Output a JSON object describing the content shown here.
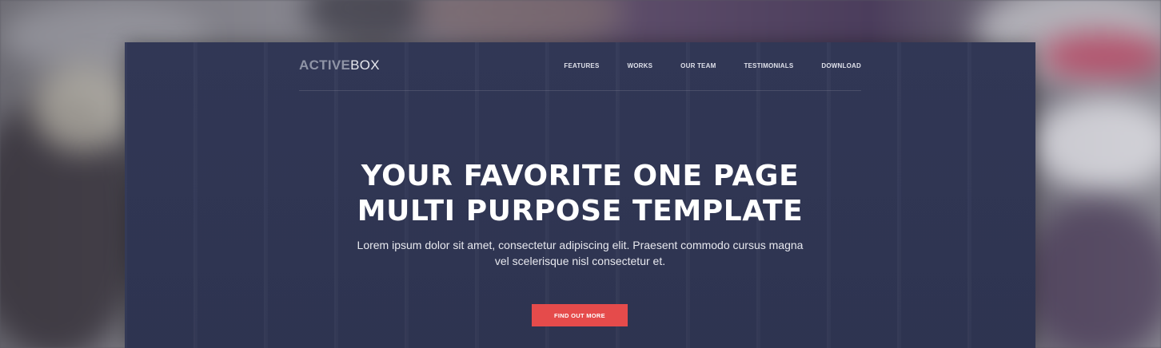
{
  "brand": {
    "logo_part1": "ACTIVE",
    "logo_part2": "BOX"
  },
  "nav": {
    "items": [
      {
        "label": "FEATURES"
      },
      {
        "label": "WORKS"
      },
      {
        "label": "OUR TEAM"
      },
      {
        "label": "TESTIMONIALS"
      },
      {
        "label": "DOWNLOAD"
      }
    ]
  },
  "hero": {
    "title_line1": "YOUR FAVORITE ONE PAGE",
    "title_line2": "MULTI PURPOSE TEMPLATE",
    "subtitle_line1": "Lorem ipsum dolor sit amet, consectetur adipiscing elit. Praesent commodo cursus magna",
    "subtitle_line2": "vel scelerisque nisl consectetur et.",
    "cta_label": "FIND OUT MORE"
  },
  "colors": {
    "background_navy": "#313755",
    "cta_red": "#e54b4b",
    "text_white": "#ffffff",
    "logo_muted": "#8f94a6"
  }
}
